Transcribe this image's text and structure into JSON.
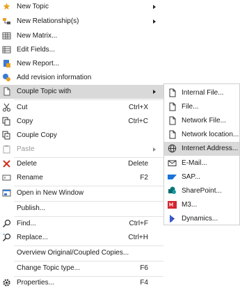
{
  "menu": {
    "items": [
      {
        "label": "New Topic",
        "shortcut": "",
        "icon": "star-icon",
        "color": "#e8a020"
      },
      {
        "label": "New Relationship(s)",
        "shortcut": "",
        "icon": "relationship-icon",
        "color": "#e8a020"
      },
      {
        "label": "New Matrix...",
        "shortcut": "",
        "icon": "matrix-icon",
        "color": "#555555"
      },
      {
        "label": "Edit Fields...",
        "shortcut": "",
        "icon": "fields-icon",
        "color": "#555555"
      },
      {
        "label": "New Report...",
        "shortcut": "",
        "icon": "report-icon",
        "color": "#3a7bd5"
      },
      {
        "label": "Add revision information",
        "shortcut": "",
        "icon": "revision-icon",
        "color": "#3a7bd5"
      },
      {
        "label": "Couple Topic with",
        "shortcut": "",
        "icon": "document-icon",
        "color": "#555555"
      },
      {
        "label": "Cut",
        "shortcut": "Ctrl+X",
        "icon": "scissors-icon",
        "color": "#333333"
      },
      {
        "label": "Copy",
        "shortcut": "Ctrl+C",
        "icon": "copy-icon",
        "color": "#333333"
      },
      {
        "label": "Couple Copy",
        "shortcut": "",
        "icon": "couple-copy-icon",
        "color": "#333333"
      },
      {
        "label": "Paste",
        "shortcut": "",
        "icon": "paste-icon",
        "color": "#aaaaaa"
      },
      {
        "label": "Delete",
        "shortcut": "Delete",
        "icon": "delete-icon",
        "color": "#d03020"
      },
      {
        "label": "Rename",
        "shortcut": "F2",
        "icon": "rename-icon",
        "color": "#555555"
      },
      {
        "label": "Open in New Window",
        "shortcut": "",
        "icon": "window-icon",
        "color": "#3a7bd5"
      },
      {
        "label": "Publish...",
        "shortcut": "",
        "icon": "",
        "color": ""
      },
      {
        "label": "Find...",
        "shortcut": "Ctrl+F",
        "icon": "find-icon",
        "color": "#333333"
      },
      {
        "label": "Replace...",
        "shortcut": "Ctrl+H",
        "icon": "replace-icon",
        "color": "#333333"
      },
      {
        "label": "Overview Original/Coupled Copies...",
        "shortcut": "",
        "icon": "",
        "color": ""
      },
      {
        "label": "Change Topic type...",
        "shortcut": "F6",
        "icon": "",
        "color": ""
      },
      {
        "label": "Properties...",
        "shortcut": "F4",
        "icon": "gear-icon",
        "color": "#333333"
      }
    ]
  },
  "submenu": {
    "items": [
      {
        "label": "Internal File...",
        "icon": "file-icon"
      },
      {
        "label": "File...",
        "icon": "file-icon"
      },
      {
        "label": "Network File...",
        "icon": "file-icon"
      },
      {
        "label": "Network location...",
        "icon": "file-icon"
      },
      {
        "label": "Internet Address...",
        "icon": "globe-icon"
      },
      {
        "label": "E-Mail...",
        "icon": "mail-icon"
      },
      {
        "label": "SAP...",
        "icon": "sap-icon"
      },
      {
        "label": "SharePoint...",
        "icon": "sharepoint-icon"
      },
      {
        "label": "M3...",
        "icon": "m3-icon"
      },
      {
        "label": "Dynamics...",
        "icon": "dynamics-icon"
      }
    ]
  },
  "colors": {
    "highlight": "#d9d9d9",
    "sap": "#1a73d9",
    "sharepoint": "#03787c",
    "m3": "#d3262f",
    "dynamics": "#2c3a8c"
  }
}
